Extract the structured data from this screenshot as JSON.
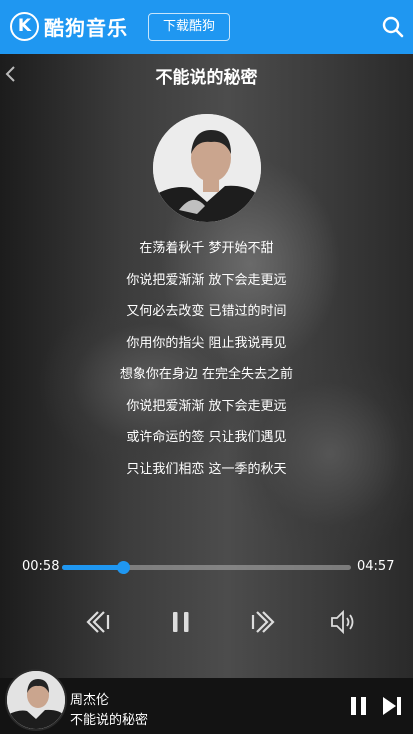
{
  "header": {
    "logo_mark": "K",
    "logo_text": "酷狗音乐",
    "download_label": "下载酷狗",
    "brand_color": "#1f97f1"
  },
  "player": {
    "title": "不能说的秘密",
    "lyrics": [
      "在荡着秋千 梦开始不甜",
      "你说把爱渐渐 放下会走更远",
      "又何必去改变 已错过的时间",
      "你用你的指尖 阻止我说再见",
      "想象你在身边 在完全失去之前",
      "你说把爱渐渐 放下会走更远",
      "或许命运的签 只让我们遇见",
      "只让我们相恋 这一季的秋天"
    ],
    "current_time": "00:58",
    "total_time": "04:57",
    "progress_fraction": 0.21
  },
  "mini": {
    "artist": "周杰伦",
    "song": "不能说的秘密"
  },
  "icons": [
    "kugou-logo-icon",
    "search-icon",
    "back-arrow-icon",
    "previous-icon",
    "pause-icon",
    "next-icon",
    "volume-icon",
    "mini-pause-icon",
    "mini-next-icon"
  ]
}
